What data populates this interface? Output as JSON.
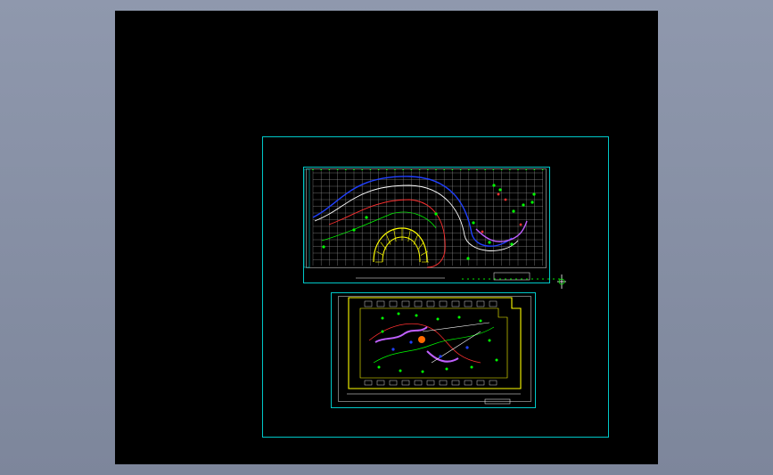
{
  "colors": {
    "background": "#8a93a8",
    "canvas": "#000000",
    "frame": "#00c8c8",
    "grid": "#ffffff",
    "accent_green": "#00ff00",
    "accent_magenta": "#c060ff",
    "accent_yellow": "#ffff00",
    "accent_red": "#ff3030",
    "accent_blue": "#2040ff"
  },
  "drawings": [
    {
      "name": "site-plan-grid-sheet"
    },
    {
      "name": "landscape-plan-sheet"
    }
  ]
}
